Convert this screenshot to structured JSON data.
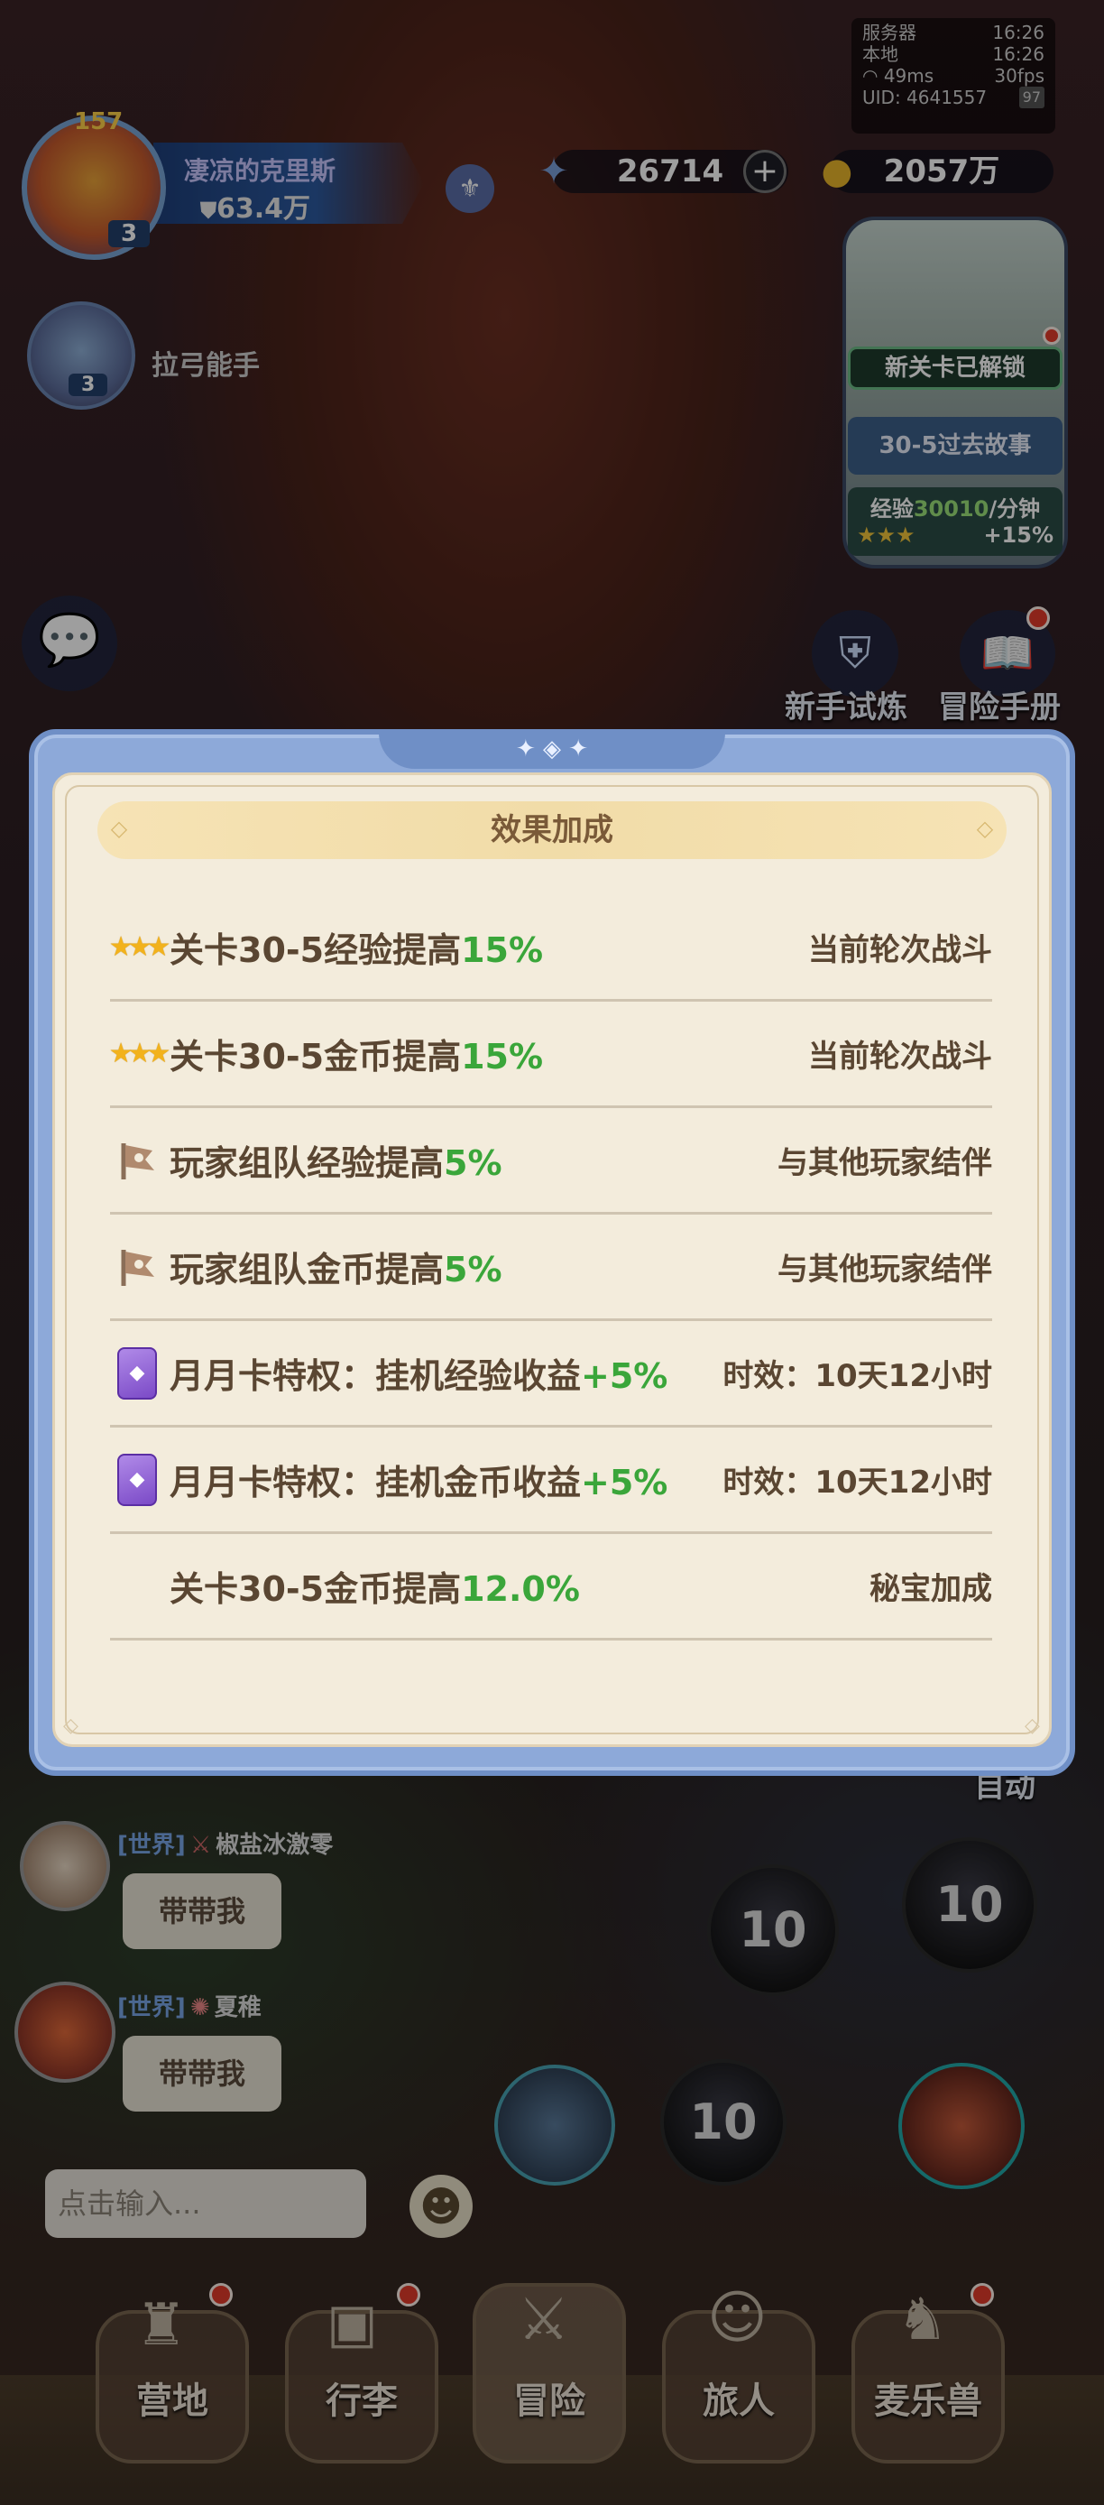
{
  "status": {
    "server_label": "服务器",
    "server_time": "16:26",
    "local_label": "本地",
    "local_time": "16:26",
    "ping": "49ms",
    "fps": "30fps",
    "uid": "UID: 4641557",
    "battery": "97"
  },
  "player": {
    "name": "凄凉的克里斯",
    "power": "63.4万",
    "level": "3",
    "avatar_badge": "157"
  },
  "companion": {
    "name": "拉弓能手",
    "level": "3"
  },
  "currency": {
    "gems": "26714",
    "gold": "2057万"
  },
  "minimap": {
    "unlock_label": "新关卡已解锁",
    "story_label": "30-5过去故事",
    "exp_label": "经验",
    "exp_value": "30010",
    "exp_unit": "/分钟",
    "bonus": "+15%"
  },
  "side_buttons": {
    "trial": "新手试炼",
    "handbook": "冒险手册"
  },
  "auto_label": "自动",
  "modal": {
    "title": "效果加成",
    "rows": [
      {
        "icon": "stars-icon",
        "text": "关卡30-5经验提高",
        "value": "15%",
        "source": "当前轮次战斗"
      },
      {
        "icon": "stars-icon",
        "text": "关卡30-5金币提高",
        "value": "15%",
        "source": "当前轮次战斗"
      },
      {
        "icon": "flag-icon",
        "text": "玩家组队经验提高",
        "value": "5%",
        "source": "与其他玩家结伴"
      },
      {
        "icon": "flag-icon",
        "text": "玩家组队金币提高",
        "value": "5%",
        "source": "与其他玩家结伴"
      },
      {
        "icon": "monthly-card-icon",
        "text": "月月卡特权：挂机经验收益",
        "value": "+5%",
        "source": "时效：10天12小时"
      },
      {
        "icon": "monthly-card-icon",
        "text": "月月卡特权：挂机金币收益",
        "value": "+5%",
        "source": "时效：10天12小时"
      },
      {
        "icon": "",
        "text": "关卡30-5金币提高",
        "value": "12.0%",
        "source": "秘宝加成"
      }
    ]
  },
  "chat": {
    "messages": [
      {
        "channel": "[世界]",
        "user": "椒盐冰激零",
        "text": "带带我"
      },
      {
        "channel": "[世界]",
        "user": "夏稚",
        "text": "带带我"
      }
    ],
    "input_placeholder": "点击输入..."
  },
  "skills": {
    "cooldown_a": "10",
    "cooldown_b": "10",
    "cooldown_c": "10"
  },
  "nav": {
    "camp": "营地",
    "bag": "行李",
    "adventure": "冒险",
    "traveler": "旅人",
    "pet": "麦乐兽"
  },
  "colors": {
    "accent_green": "#3aa63a",
    "modal_blue": "#8da9d9",
    "parchment": "#f3ecdc"
  }
}
